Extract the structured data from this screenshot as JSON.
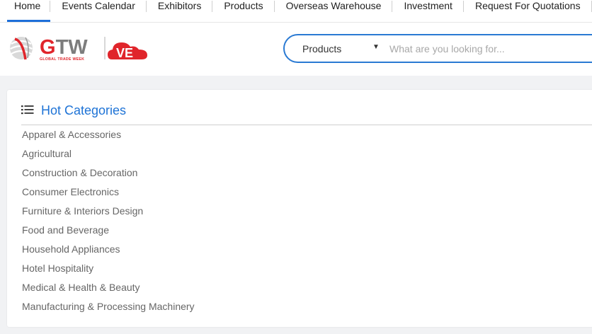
{
  "nav": {
    "items": [
      {
        "label": "Home",
        "active": true
      },
      {
        "label": "Events Calendar"
      },
      {
        "label": "Exhibitors"
      },
      {
        "label": "Products"
      },
      {
        "label": "Overseas Warehouse"
      },
      {
        "label": "Investment"
      },
      {
        "label": "Request For Quotations"
      }
    ]
  },
  "logo": {
    "main": "GTW",
    "sub": "GLOBAL TRADE WEEK",
    "badge": "VE"
  },
  "search": {
    "category": "Products",
    "placeholder": "What are you looking for..."
  },
  "hot_categories": {
    "title": "Hot Categories",
    "items": [
      "Apparel & Accessories",
      "Agricultural",
      "Construction & Decoration",
      "Consumer Electronics",
      "Furniture & Interiors Design",
      "Food and Beverage",
      "Household Appliances",
      "Hotel Hospitality",
      "Medical & Health & Beauty",
      "Manufacturing & Processing Machinery"
    ]
  },
  "colors": {
    "accent": "#1e73d6",
    "brand_red": "#e0252b",
    "brand_gray": "#7d7d7d"
  }
}
